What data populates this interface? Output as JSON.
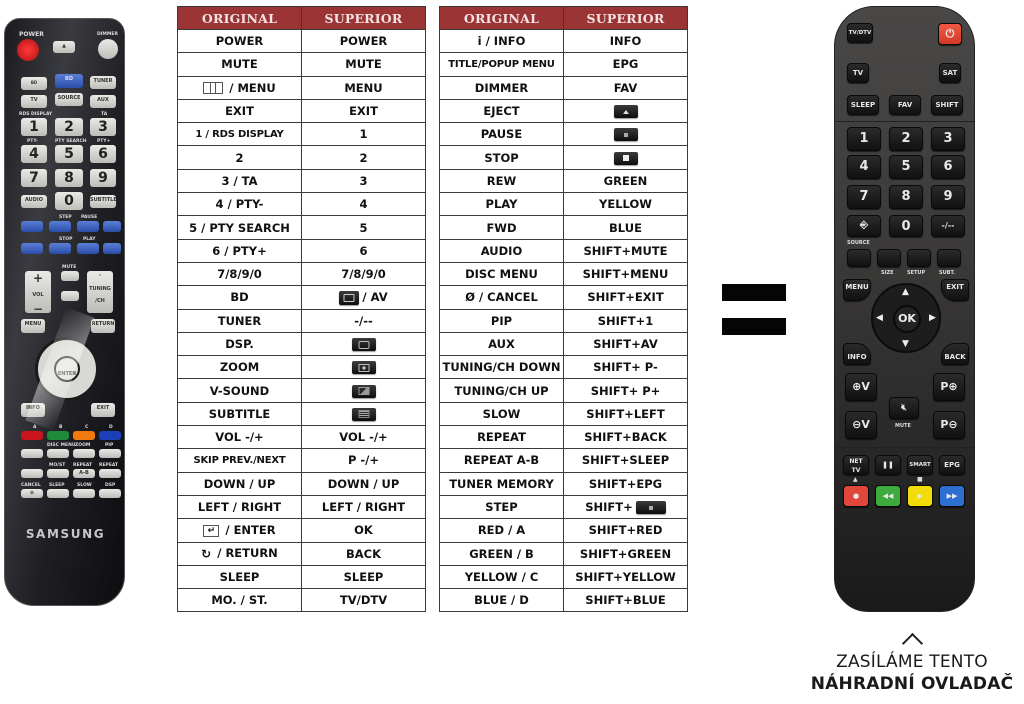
{
  "tables": {
    "left": {
      "headers": [
        "ORIGINAL",
        "SUPERIOR"
      ],
      "rows": [
        {
          "original": "POWER",
          "superior": "POWER"
        },
        {
          "original": "MUTE",
          "superior": "MUTE"
        },
        {
          "original": "/ MENU",
          "original_icon": "menu-icon",
          "superior": "MENU"
        },
        {
          "original": "EXIT",
          "superior": "EXIT"
        },
        {
          "original": "1 / RDS DISPLAY",
          "superior": "1"
        },
        {
          "original": "2",
          "superior": "2"
        },
        {
          "original": "3 / TA",
          "superior": "3"
        },
        {
          "original": "4 / PTY-",
          "superior": "4"
        },
        {
          "original": "5 / PTY SEARCH",
          "superior": "5"
        },
        {
          "original": "6 / PTY+",
          "superior": "6"
        },
        {
          "original": "7/8/9/0",
          "superior": "7/8/9/0"
        },
        {
          "original": "BD",
          "superior": "/ AV",
          "superior_icon": "source-key-icon"
        },
        {
          "original": "TUNER",
          "superior": "-/--"
        },
        {
          "original": "DSP.",
          "superior": "",
          "superior_icon": "screen-key-icon"
        },
        {
          "original": "ZOOM",
          "superior": "",
          "superior_icon": "size-key-icon"
        },
        {
          "original": "V-SOUND",
          "superior": "",
          "superior_icon": "setup-key-icon"
        },
        {
          "original": "SUBTITLE",
          "superior": "",
          "superior_icon": "subtitle-key-icon"
        },
        {
          "original": "VOL -/+",
          "superior": "VOL -/+"
        },
        {
          "original": "SKIP PREV./NEXT",
          "superior": "P -/+"
        },
        {
          "original": "DOWN / UP",
          "superior": "DOWN / UP"
        },
        {
          "original": "LEFT / RIGHT",
          "superior": "LEFT / RIGHT"
        },
        {
          "original": "/ ENTER",
          "original_icon": "enter-icon",
          "superior": "OK"
        },
        {
          "original": "/ RETURN",
          "original_icon": "return-icon",
          "superior": "BACK"
        },
        {
          "original": "SLEEP",
          "superior": "SLEEP"
        },
        {
          "original": "MO. / ST.",
          "superior": "TV/DTV"
        }
      ]
    },
    "right": {
      "headers": [
        "ORIGINAL",
        "SUPERIOR"
      ],
      "rows": [
        {
          "original": "i / INFO",
          "superior": "INFO"
        },
        {
          "original": "TITLE/POPUP MENU",
          "superior": "EPG"
        },
        {
          "original": "DIMMER",
          "superior": "FAV"
        },
        {
          "original": "EJECT",
          "superior": "",
          "superior_icon": "eject-key-icon"
        },
        {
          "original": "PAUSE",
          "superior": "",
          "superior_icon": "pause-key-icon"
        },
        {
          "original": "STOP",
          "superior": "",
          "superior_icon": "stop-key-icon"
        },
        {
          "original": "REW",
          "superior": "GREEN"
        },
        {
          "original": "PLAY",
          "superior": "YELLOW"
        },
        {
          "original": "FWD",
          "superior": "BLUE"
        },
        {
          "original": "AUDIO",
          "superior": "SHIFT+MUTE"
        },
        {
          "original": "DISC MENU",
          "superior": "SHIFT+MENU"
        },
        {
          "original": "Ø / CANCEL",
          "superior": "SHIFT+EXIT"
        },
        {
          "original": "PIP",
          "superior": "SHIFT+1"
        },
        {
          "original": "AUX",
          "superior": "SHIFT+AV"
        },
        {
          "original": "TUNING/CH DOWN",
          "superior": "SHIFT+ P-"
        },
        {
          "original": "TUNING/CH UP",
          "superior": "SHIFT+ P+"
        },
        {
          "original": "SLOW",
          "superior": "SHIFT+LEFT"
        },
        {
          "original": "REPEAT",
          "superior": "SHIFT+BACK"
        },
        {
          "original": "REPEAT A-B",
          "superior": "SHIFT+SLEEP"
        },
        {
          "original": "TUNER MEMORY",
          "superior": "SHIFT+EPG"
        },
        {
          "original": "STEP",
          "superior": "SHIFT+",
          "superior_icon": "pause-key-icon"
        },
        {
          "original": "RED / A",
          "superior": "SHIFT+RED"
        },
        {
          "original": "GREEN / B",
          "superior": "SHIFT+GREEN"
        },
        {
          "original": "YELLOW / C",
          "superior": "SHIFT+YELLOW"
        },
        {
          "original": "BLUE / D",
          "superior": "SHIFT+BLUE"
        }
      ]
    }
  },
  "caption": {
    "line1": "ZASÍLÁME TENTO",
    "line2": "NÁHRADNÍ OVLADAČ"
  },
  "original_remote": {
    "brand": "SAMSUNG",
    "labels": {
      "power": "POWER",
      "dimmer": "DIMMER",
      "bd": "BD",
      "tuner": "TUNER",
      "tv": "TV",
      "source": "SOURCE",
      "aux": "AUX",
      "rds": "RDS DISPLAY",
      "ta": "TA",
      "pty_minus": "PTY-",
      "pty_search": "PTY SEARCH",
      "pty_plus": "PTY+",
      "audio": "AUDIO",
      "subtitle": "SUBTITLE",
      "step": "STEP",
      "pause": "PAUSE",
      "stop": "STOP",
      "play": "PLAY",
      "mute": "MUTE",
      "vol": "VOL",
      "tuning": "TUNING /CH",
      "vsound": "V-SOUND",
      "enter": "ENTER",
      "a": "A",
      "b": "B",
      "c": "C",
      "d": "D",
      "disc_menu": "DISC MENU",
      "zoom": "ZOOM",
      "pip": "PIP",
      "most": "MO/ST",
      "repeat": "REPEAT",
      "cancel": "CANCEL",
      "sleep": "SLEEP",
      "slow": "SLOW",
      "dsp": "DSP",
      "ab": "A-B"
    },
    "digits": [
      "1",
      "2",
      "3",
      "4",
      "5",
      "6",
      "7",
      "8",
      "9",
      "0"
    ],
    "colors": {
      "power": "#d81e1e",
      "red": "#c8141a",
      "green": "#1f8a3a",
      "yellow": "#f07a10",
      "blue": "#1b3fb8"
    }
  },
  "replacement_remote": {
    "labels": {
      "tvdtv": "TV/DTV",
      "tv": "TV",
      "sat": "SAT",
      "sleep": "SLEEP",
      "fav": "FAV",
      "shift": "SHIFT",
      "dash": "-/--",
      "source": "SOURCE",
      "size": "SIZE",
      "setup": "SETUP",
      "subt": "SUBT.",
      "menu": "MENU",
      "exit": "EXIT",
      "ok": "OK",
      "info": "INFO",
      "back": "BACK",
      "vol_up": "⊕V",
      "vol_down": "⊖V",
      "p_up": "P⊕",
      "p_down": "P⊖",
      "mute": "MUTE",
      "nettv": "NET TV",
      "smart": "SMART",
      "epg": "EPG"
    },
    "digits": [
      "1",
      "2",
      "3",
      "4",
      "5",
      "6",
      "7",
      "8",
      "9",
      "0"
    ],
    "colors": {
      "power": "#e8432f",
      "red": "#e0463a",
      "green": "#3eaa3e",
      "yellow": "#f2dc0a",
      "blue": "#2d6fd0"
    }
  }
}
